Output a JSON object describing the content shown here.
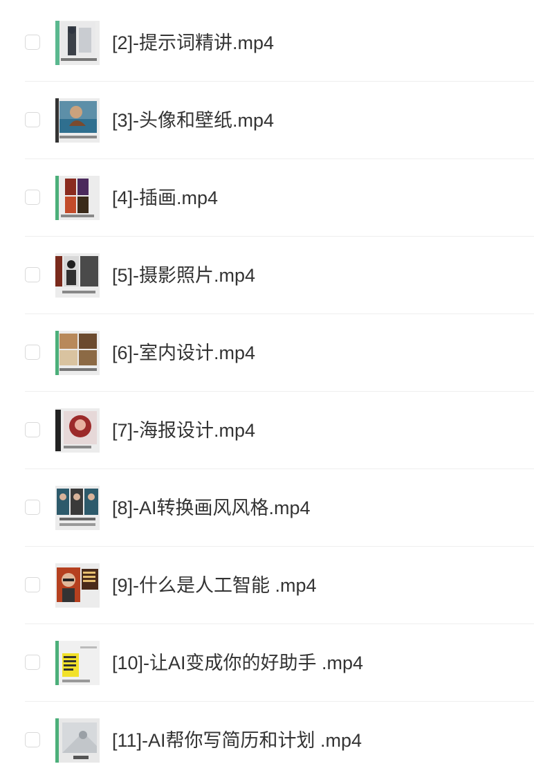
{
  "files": [
    {
      "name": "[2]-提示词精讲.mp4",
      "thumbnail": "video-thumbnail-prompt",
      "accent": "#2e3440"
    },
    {
      "name": "[3]-头像和壁纸.mp4",
      "thumbnail": "video-thumbnail-avatar",
      "accent": "#2f6f8f"
    },
    {
      "name": "[4]-插画.mp4",
      "thumbnail": "video-thumbnail-illustration",
      "accent": "#8a2b1f"
    },
    {
      "name": "[5]-摄影照片.mp4",
      "thumbnail": "video-thumbnail-photography",
      "accent": "#202020"
    },
    {
      "name": "[6]-室内设计.mp4",
      "thumbnail": "video-thumbnail-interior",
      "accent": "#b8895a"
    },
    {
      "name": "[7]-海报设计.mp4",
      "thumbnail": "video-thumbnail-poster",
      "accent": "#9c2a2a"
    },
    {
      "name": "[8]-AI转换画风风格.mp4",
      "thumbnail": "video-thumbnail-style",
      "accent": "#2d5a6b"
    },
    {
      "name": "[9]-什么是人工智能 .mp4",
      "thumbnail": "video-thumbnail-ai-intro",
      "accent": "#b5401f"
    },
    {
      "name": "[10]-让AI变成你的好助手 .mp4",
      "thumbnail": "video-thumbnail-assistant",
      "accent": "#f2e12a"
    },
    {
      "name": "[11]-AI帮你写简历和计划 .mp4",
      "thumbnail": "video-thumbnail-resume",
      "accent": "#9aa0a6"
    }
  ]
}
